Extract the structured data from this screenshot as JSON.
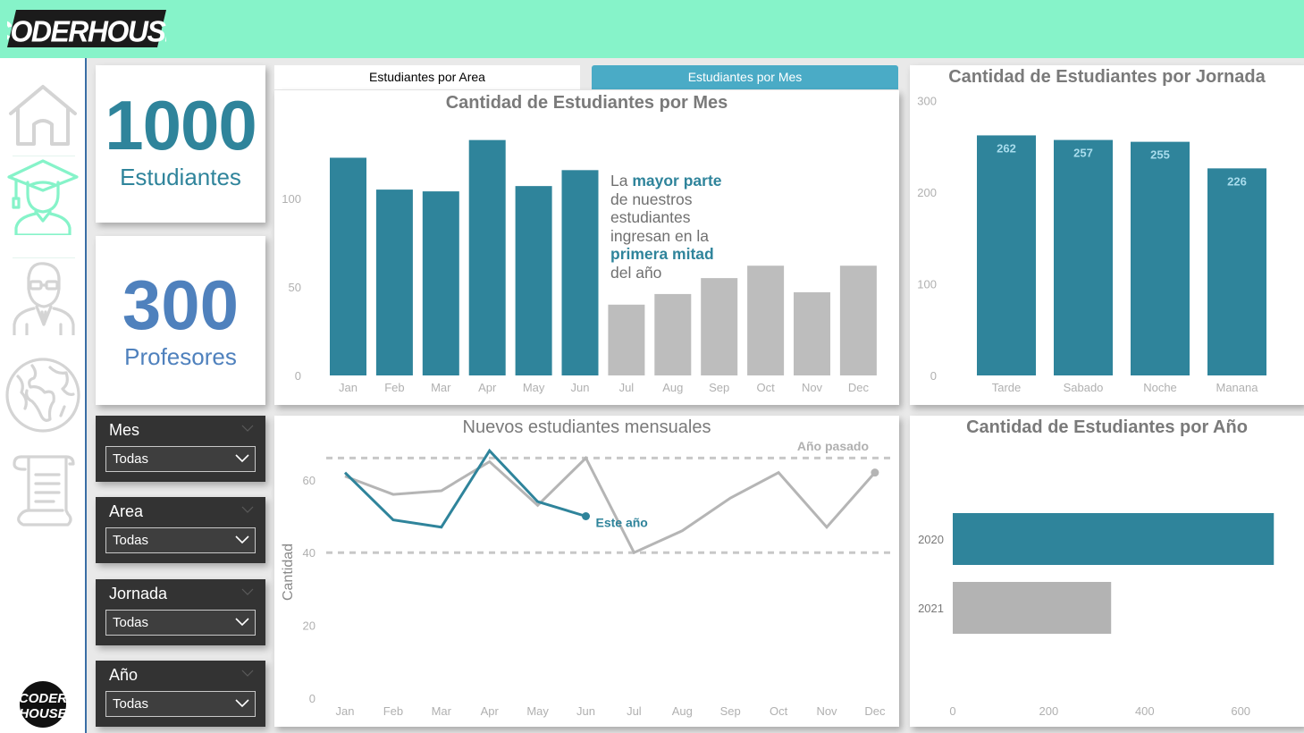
{
  "header": {
    "brand": "CODERHOUSE",
    "background_color": "#86f3c9"
  },
  "sidebar": {
    "items": [
      {
        "name": "home",
        "icon": "house-icon",
        "active": false
      },
      {
        "name": "students",
        "icon": "graduate-student-icon",
        "active": true
      },
      {
        "name": "teachers",
        "icon": "teacher-icon",
        "active": false
      },
      {
        "name": "regions",
        "icon": "globe-icon",
        "active": false
      },
      {
        "name": "reports",
        "icon": "scroll-icon",
        "active": false
      }
    ],
    "bottom_logo_line1": "CODER",
    "bottom_logo_line2": "HOUSE",
    "active_color": "#86f3c9",
    "inactive_color": "#d4d4d4"
  },
  "kpis": [
    {
      "value": "1000",
      "label": "Estudiantes",
      "color": "#2f849b"
    },
    {
      "value": "300",
      "label": "Profesores",
      "color": "#4f81bd"
    }
  ],
  "filters": [
    {
      "title": "Mes",
      "value": "Todas"
    },
    {
      "title": "Area",
      "value": "Todas"
    },
    {
      "title": "Jornada",
      "value": "Todas"
    },
    {
      "title": "Año",
      "value": "Todas"
    }
  ],
  "tabs": [
    {
      "label": "Estudiantes por Area",
      "active": false
    },
    {
      "label": "Estudiantes por Mes",
      "active": true
    }
  ],
  "colors": {
    "accent": "#2f849b",
    "muted": "#bdbdbd",
    "tab_active": "#4aabc6",
    "title_text": "#7a7a7a",
    "axis_text": "#b0b0b0"
  },
  "annotation": {
    "p1": "La ",
    "h1": "mayor parte",
    "p2": "de nuestros",
    "p3": "estudiantes",
    "p4": "ingresan en la",
    "h2": "primera mitad",
    "p5": "del año"
  },
  "chart_data": [
    {
      "id": "monthly",
      "type": "bar",
      "title": "Cantidad de Estudiantes por Mes",
      "categories": [
        "Jan",
        "Feb",
        "Mar",
        "Apr",
        "May",
        "Jun",
        "Jul",
        "Aug",
        "Sep",
        "Oct",
        "Nov",
        "Dec"
      ],
      "values": [
        123,
        105,
        104,
        133,
        107,
        116,
        40,
        46,
        55,
        62,
        47,
        62
      ],
      "highlight_first_n": 6,
      "yticks": [
        0,
        50,
        100
      ],
      "ylim": [
        0,
        135
      ],
      "xlabel": "",
      "ylabel": "",
      "grid": false
    },
    {
      "id": "jornada",
      "type": "bar",
      "title": "Cantidad de Estudiantes por Jornada",
      "categories": [
        "Tarde",
        "Sabado",
        "Noche",
        "Manana"
      ],
      "values": [
        262,
        257,
        255,
        226
      ],
      "data_labels": [
        "262",
        "257",
        "255",
        "226"
      ],
      "yticks": [
        0,
        100,
        200,
        300
      ],
      "ylim": [
        0,
        300
      ],
      "grid": false
    },
    {
      "id": "monthly-line",
      "type": "line",
      "title": "Nuevos estudiantes mensuales",
      "x": [
        "Jan",
        "Feb",
        "Mar",
        "Apr",
        "May",
        "Jun",
        "Jul",
        "Aug",
        "Sep",
        "Oct",
        "Nov",
        "Dec"
      ],
      "series": [
        {
          "name": "Año pasado",
          "values": [
            61,
            56,
            57,
            65,
            53,
            66,
            40,
            46,
            55,
            62,
            47,
            62
          ],
          "color": "#b5b5b5"
        },
        {
          "name": "Este año",
          "values": [
            62,
            49,
            47,
            68,
            54,
            50
          ],
          "color": "#2f849b"
        }
      ],
      "reference_lines": [
        40,
        66
      ],
      "yticks": [
        0,
        20,
        40,
        60
      ],
      "ylim": [
        0,
        70
      ],
      "ylabel": "Cantidad",
      "xlabel": "",
      "legend": "inline-labels"
    },
    {
      "id": "year",
      "type": "bar",
      "orientation": "horizontal",
      "title": "Cantidad de Estudiantes por Año",
      "categories": [
        "2020",
        "2021"
      ],
      "values": [
        669,
        330
      ],
      "xticks": [
        0,
        200,
        400,
        600
      ],
      "xlim": [
        0,
        700
      ],
      "grid": false
    }
  ]
}
